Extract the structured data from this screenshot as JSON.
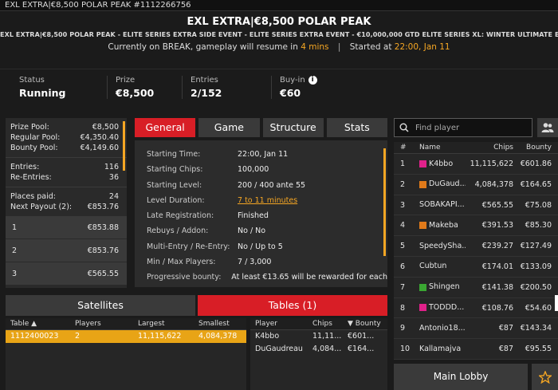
{
  "window": {
    "title": "EXL EXTRA|€8,500 POLAR PEAK #1112266756"
  },
  "header": {
    "title": "EXL EXTRA|€8,500 POLAR PEAK",
    "subtitle": "EXL EXTRA|€8,500 POLAR PEAK - ELITE SERIES EXTRA SIDE EVENT - ELITE SERIES EXTRA EVENT - €10,000,000 GTD ELITE SERIES XL: WINTER ULTIMATE EDITION",
    "status_prefix": "Currently on BREAK, gameplay will resume in",
    "status_mins": "4 mins",
    "started_label": "Started at",
    "started_value": "22:00, Jan 11"
  },
  "stats": {
    "status_label": "Status",
    "status_value": "Running",
    "prize_label": "Prize",
    "prize_value": "€8,500",
    "entries_label": "Entries",
    "entries_value": "2/152",
    "buyin_label": "Buy-in",
    "buyin_value": "€60"
  },
  "prize": {
    "prize_pool_label": "Prize Pool:",
    "prize_pool_value": "€8,500",
    "regular_label": "Regular Pool:",
    "regular_value": "€4,350.40",
    "bounty_label": "Bounty Pool:",
    "bounty_value": "€4,149.60",
    "entries_label": "Entries:",
    "entries_value": "116",
    "reentries_label": "Re-Entries:",
    "reentries_value": "36",
    "places_label": "Places paid:",
    "places_value": "24",
    "next_label": "Next Payout (2):",
    "next_value": "€853.76",
    "payouts": [
      {
        "place": "1",
        "amount": "€853.88"
      },
      {
        "place": "2",
        "amount": "€853.76"
      },
      {
        "place": "3",
        "amount": "€565.55"
      }
    ]
  },
  "tabs": [
    "General",
    "Game",
    "Structure",
    "Stats"
  ],
  "general": [
    {
      "k": "Starting Time:",
      "v": "22:00, Jan 11"
    },
    {
      "k": "Starting Chips:",
      "v": "100,000"
    },
    {
      "k": "Starting Level:",
      "v": "200 / 400 ante 55"
    },
    {
      "k": "Level Duration:",
      "v": "7 to 11 minutes"
    },
    {
      "k": "Late Registration:",
      "v": "Finished"
    },
    {
      "k": "Rebuys / Addon:",
      "v": "No / No"
    },
    {
      "k": "Multi-Entry / Re-Entry:",
      "v": "No / Up to 5"
    },
    {
      "k": "Min / Max Players:",
      "v": "7 / 3,000"
    },
    {
      "k": "Progressive bounty:",
      "v": "At least €13.65 will be rewarded for each"
    }
  ],
  "search": {
    "placeholder": "Find player"
  },
  "players": {
    "headers": {
      "rank": "#",
      "name": "Name",
      "chips": "Chips",
      "bounty": "Bounty"
    },
    "rows": [
      {
        "rank": "1",
        "name": "K4bbo",
        "chips": "11,115,622",
        "bounty": "€601.86",
        "flag": "#e0218a"
      },
      {
        "rank": "2",
        "name": "DuGaud...",
        "chips": "4,084,378",
        "bounty": "€164.65",
        "flag": "#e07a1a"
      },
      {
        "rank": "3",
        "name": "SOBAKAPI...",
        "chips": "€565.55",
        "bounty": "€75.08",
        "flag": ""
      },
      {
        "rank": "4",
        "name": "Makeba",
        "chips": "€391.53",
        "bounty": "€85.30",
        "flag": "#e07a1a"
      },
      {
        "rank": "5",
        "name": "SpeedySha...",
        "chips": "€239.27",
        "bounty": "€127.49",
        "flag": ""
      },
      {
        "rank": "6",
        "name": "Cubtun",
        "chips": "€174.01",
        "bounty": "€133.09",
        "flag": ""
      },
      {
        "rank": "7",
        "name": "Shingen",
        "chips": "€141.38",
        "bounty": "€200.50",
        "flag": "#3aa632"
      },
      {
        "rank": "8",
        "name": "TODDD...",
        "chips": "€108.76",
        "bounty": "€54.60",
        "flag": "#e0218a"
      },
      {
        "rank": "9",
        "name": "Antonio18...",
        "chips": "€87",
        "bounty": "€143.34",
        "flag": ""
      },
      {
        "rank": "10",
        "name": "Kallamajva",
        "chips": "€87",
        "bounty": "€95.55",
        "flag": ""
      }
    ]
  },
  "bottom_tabs": {
    "satellites": "Satellites",
    "tables": "Tables (1)"
  },
  "tables": {
    "headers": {
      "table": "Table",
      "players": "Players",
      "largest": "Largest",
      "smallest": "Smallest"
    },
    "rows": [
      {
        "table": "1112400023",
        "players": "2",
        "largest": "11,115,622",
        "smallest": "4,084,378"
      }
    ]
  },
  "table_players": {
    "headers": {
      "player": "Player",
      "chips": "Chips",
      "bounty": "Bounty"
    },
    "rows": [
      {
        "player": "K4bbo",
        "chips": "11,11...",
        "bounty": "€601..."
      },
      {
        "player": "DuGaudreau",
        "chips": "4,084...",
        "bounty": "€164..."
      }
    ]
  },
  "buttons": {
    "main_lobby": "Main Lobby"
  },
  "colors": {
    "accent_red": "#d81e26",
    "accent_orange": "#f5a623",
    "selected_row": "#e8a416"
  }
}
